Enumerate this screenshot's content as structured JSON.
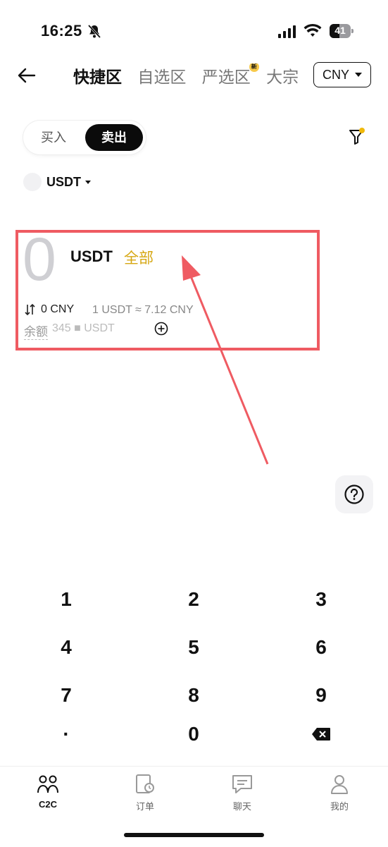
{
  "status_bar": {
    "time": "16:25",
    "battery": "41"
  },
  "header": {
    "tabs": [
      {
        "label": "快捷区",
        "active": true
      },
      {
        "label": "自选区",
        "active": false
      },
      {
        "label": "严选区",
        "active": false,
        "badge": "新"
      },
      {
        "label": "大宗",
        "active": false
      }
    ],
    "currency": "CNY"
  },
  "trade_toggle": {
    "buy_label": "买入",
    "sell_label": "卖出",
    "selected": "卖出"
  },
  "coin_selector": {
    "coin": "USDT"
  },
  "amount": {
    "value": "0",
    "coin": "USDT",
    "all_label": "全部",
    "converted": "0 CNY",
    "rate": "1 USDT ≈ 7.12 CNY",
    "balance_label": "余额",
    "balance_value": "345 ■      USDT"
  },
  "keypad": {
    "keys": [
      "1",
      "2",
      "3",
      "4",
      "5",
      "6",
      "7",
      "8",
      "9",
      "·",
      "0"
    ]
  },
  "bottom_nav": {
    "items": [
      {
        "label": "C2C",
        "icon": "c2c-people-icon",
        "active": true
      },
      {
        "label": "订单",
        "icon": "order-clock-icon",
        "active": false
      },
      {
        "label": "聊天",
        "icon": "chat-icon",
        "active": false
      },
      {
        "label": "我的",
        "icon": "profile-icon",
        "active": false
      }
    ]
  },
  "colors": {
    "accent": "#d6a712",
    "highlight_box": "#ef5b62",
    "dark": "#0b0b0b"
  }
}
